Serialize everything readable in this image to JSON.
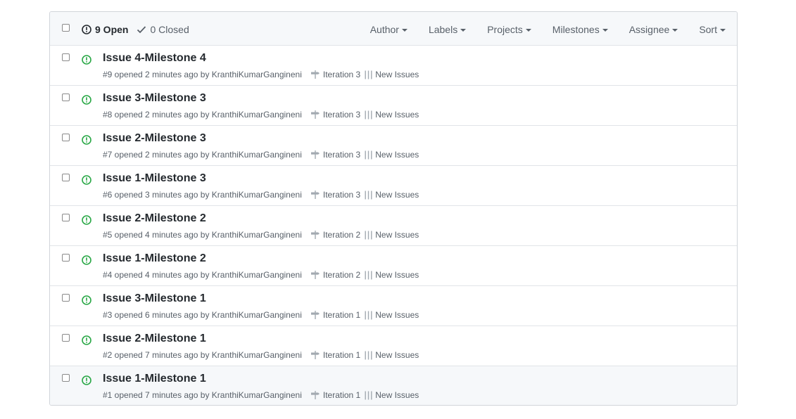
{
  "header": {
    "open_count": "9 Open",
    "closed_count": "0 Closed",
    "filters": [
      "Author",
      "Labels",
      "Projects",
      "Milestones",
      "Assignee",
      "Sort"
    ]
  },
  "colors": {
    "open_green": "#28a745",
    "muted": "#586069",
    "border": "#e1e4e8"
  },
  "issues": [
    {
      "title": "Issue 4-Milestone 4",
      "meta": "#9 opened 2 minutes ago by KranthiKumarGangineni",
      "milestone": "Iteration 3",
      "project": "New Issues"
    },
    {
      "title": "Issue 3-Milestone 3",
      "meta": "#8 opened 2 minutes ago by KranthiKumarGangineni",
      "milestone": "Iteration 3",
      "project": "New Issues"
    },
    {
      "title": "Issue 2-Milestone 3",
      "meta": "#7 opened 2 minutes ago by KranthiKumarGangineni",
      "milestone": "Iteration 3",
      "project": "New Issues"
    },
    {
      "title": "Issue 1-Milestone 3",
      "meta": "#6 opened 3 minutes ago by KranthiKumarGangineni",
      "milestone": "Iteration 3",
      "project": "New Issues"
    },
    {
      "title": "Issue 2-Milestone 2",
      "meta": "#5 opened 4 minutes ago by KranthiKumarGangineni",
      "milestone": "Iteration 2",
      "project": "New Issues"
    },
    {
      "title": "Issue 1-Milestone 2",
      "meta": "#4 opened 4 minutes ago by KranthiKumarGangineni",
      "milestone": "Iteration 2",
      "project": "New Issues"
    },
    {
      "title": "Issue 3-Milestone 1",
      "meta": "#3 opened 6 minutes ago by KranthiKumarGangineni",
      "milestone": "Iteration 1",
      "project": "New Issues"
    },
    {
      "title": "Issue 2-Milestone 1",
      "meta": "#2 opened 7 minutes ago by KranthiKumarGangineni",
      "milestone": "Iteration 1",
      "project": "New Issues"
    },
    {
      "title": "Issue 1-Milestone 1",
      "meta": "#1 opened 7 minutes ago by KranthiKumarGangineni",
      "milestone": "Iteration 1",
      "project": "New Issues"
    }
  ]
}
